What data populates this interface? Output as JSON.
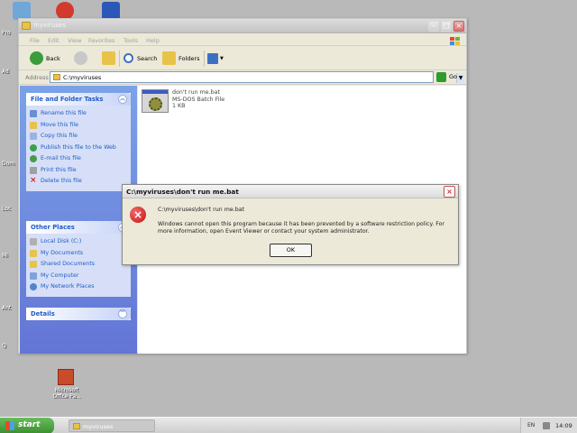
{
  "window": {
    "title": "myviruses",
    "menu": [
      "File",
      "Edit",
      "View",
      "Favorites",
      "Tools",
      "Help"
    ],
    "toolbar": {
      "back": "Back",
      "search": "Search",
      "folders": "Folders"
    },
    "address": {
      "label": "Address",
      "value": "C:\\myviruses",
      "go": "Go"
    }
  },
  "tasks_panel": {
    "title": "File and Folder Tasks",
    "items": [
      {
        "label": "Rename this file",
        "icon": "rename-icon"
      },
      {
        "label": "Move this file",
        "icon": "move-icon"
      },
      {
        "label": "Copy this file",
        "icon": "copy-icon"
      },
      {
        "label": "Publish this file to the Web",
        "icon": "publish-web-icon"
      },
      {
        "label": "E-mail this file",
        "icon": "email-icon"
      },
      {
        "label": "Print this file",
        "icon": "print-icon"
      },
      {
        "label": "Delete this file",
        "icon": "delete-icon"
      }
    ]
  },
  "places_panel": {
    "title": "Other Places",
    "items": [
      {
        "label": "Local Disk (C:)",
        "icon": "disk-icon"
      },
      {
        "label": "My Documents",
        "icon": "documents-icon"
      },
      {
        "label": "Shared Documents",
        "icon": "shared-documents-icon"
      },
      {
        "label": "My Computer",
        "icon": "computer-icon"
      },
      {
        "label": "My Network Places",
        "icon": "network-icon"
      }
    ]
  },
  "details_panel": {
    "title": "Details"
  },
  "file": {
    "name": "don't run me.bat",
    "type": "MS-DOS Batch File",
    "size": "1 KB"
  },
  "dialog": {
    "title": "C:\\myviruses\\don't run me.bat",
    "path": "C:\\myviruses\\don't run me.bat",
    "message": "Windows cannot open this program because it has been prevented by a software restriction policy. For more information, open Event Viewer or contact your system administrator.",
    "ok": "OK"
  },
  "desktop": {
    "shortcut_label": "Microsoft Office Pa...",
    "fragments": [
      "Pro",
      "Ad",
      "Dom",
      "Loc",
      "Mi",
      "Ant",
      "Q"
    ]
  },
  "taskbar": {
    "start": "start",
    "task": "myviruses",
    "lang": "EN",
    "clock": "14:09"
  },
  "colors": {
    "accent_blue": "#215dc6",
    "error_red": "#c41010",
    "start_green": "#3c8d2f"
  }
}
